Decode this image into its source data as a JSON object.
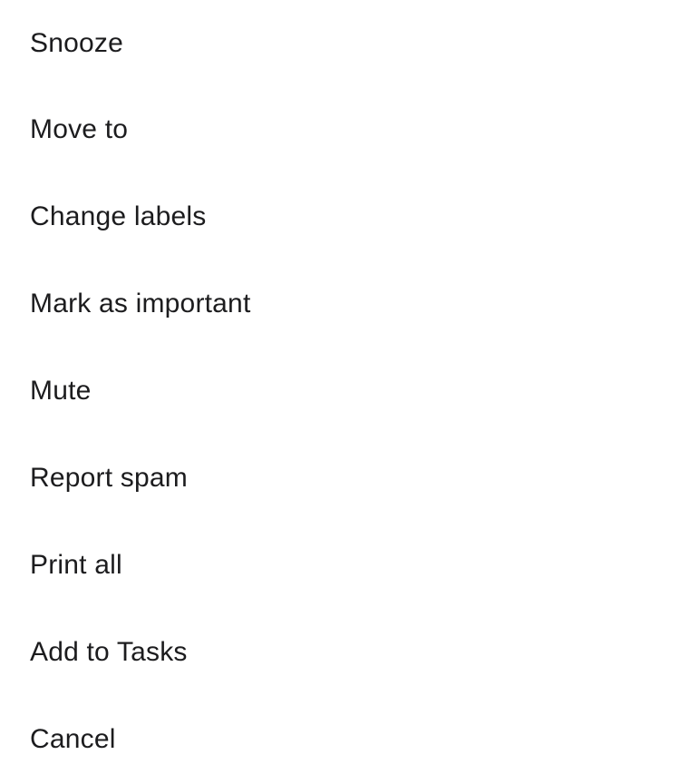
{
  "menu": {
    "items": [
      {
        "label": "Snooze"
      },
      {
        "label": "Move to"
      },
      {
        "label": "Change labels"
      },
      {
        "label": "Mark as important"
      },
      {
        "label": "Mute"
      },
      {
        "label": "Report spam"
      },
      {
        "label": "Print all"
      },
      {
        "label": "Add to Tasks"
      },
      {
        "label": "Cancel"
      }
    ]
  }
}
